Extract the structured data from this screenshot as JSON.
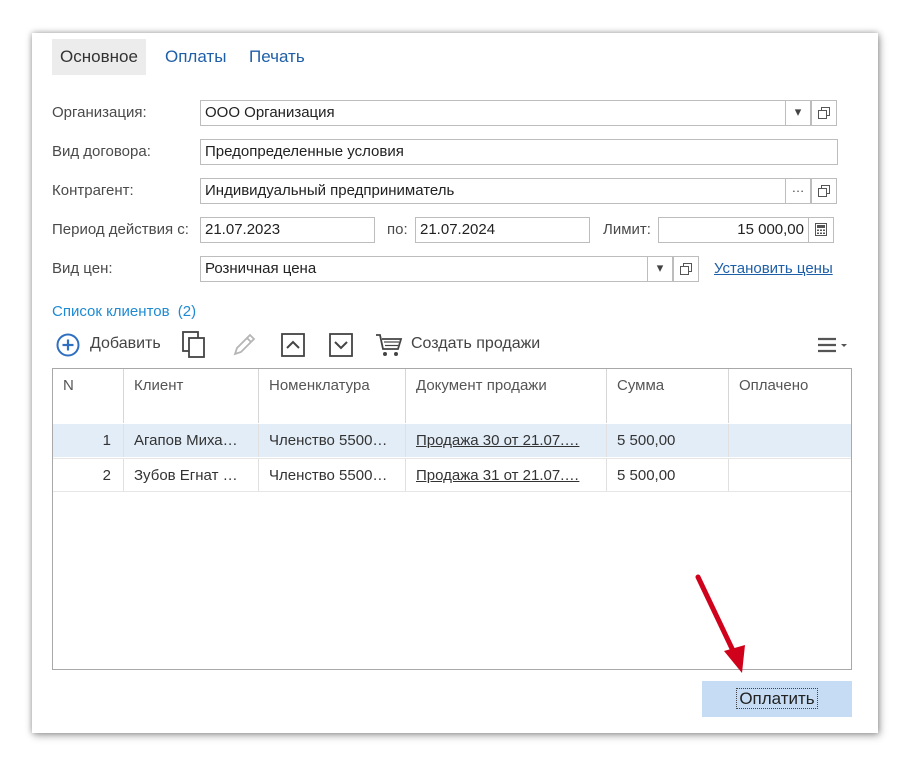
{
  "tabs": [
    {
      "label": "Основное"
    },
    {
      "label": "Оплаты"
    },
    {
      "label": "Печать"
    }
  ],
  "form": {
    "organization": {
      "label": "Организация:",
      "value": "ООО Организация"
    },
    "contract_type": {
      "label": "Вид договора:",
      "value": "Предопределенные условия"
    },
    "counterparty": {
      "label": "Контрагент:",
      "value": "Индивидуальный предприниматель"
    },
    "period": {
      "label": "Период действия с:",
      "from": "21.07.2023",
      "to_label": "по:",
      "to": "21.07.2024"
    },
    "limit": {
      "label": "Лимит:",
      "value": "15 000,00"
    },
    "price_type": {
      "label": "Вид цен:",
      "value": "Розничная цена",
      "set_prices_link": "Установить цены"
    }
  },
  "clients": {
    "title": "Список клиентов",
    "count": "(2)",
    "toolbar": {
      "add_label": "Добавить",
      "create_sales_label": "Создать продажи"
    },
    "columns": [
      "N",
      "Клиент",
      "Номенклатура",
      "Документ продажи",
      "Сумма",
      "Оплачено"
    ],
    "rows": [
      {
        "n": "1",
        "client": "Агапов Миха…",
        "item": "Членство 5500…",
        "doc": "Продажа 30 от 21.07.…",
        "sum": "5 500,00",
        "paid": ""
      },
      {
        "n": "2",
        "client": "Зубов Егнат …",
        "item": "Членство 5500…",
        "doc": "Продажа 31 от 21.07.…",
        "sum": "5 500,00",
        "paid": ""
      }
    ]
  },
  "pay_button": "Оплатить",
  "colors": {
    "accent": "#1e5fa8",
    "selected_row": "#e3edf8",
    "pay_button_bg": "#c5dcf4",
    "arrow": "#d0021b"
  }
}
